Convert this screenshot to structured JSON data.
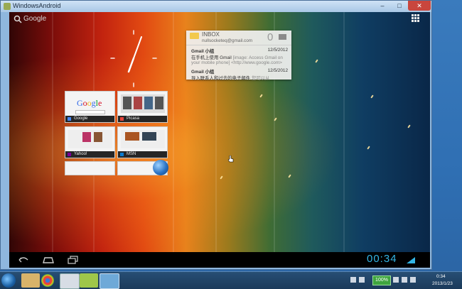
{
  "window": {
    "title": "WindowsAndroid",
    "minimize_glyph": "–",
    "maximize_glyph": "□",
    "close_glyph": "✕"
  },
  "android": {
    "search_label": "Google",
    "icons": {
      "search": "search-icon",
      "apps": "all-apps-icon"
    },
    "clock": {
      "type": "analog",
      "hour_angle_deg": 200,
      "minute_angle_deg": 22
    },
    "gmail_widget": {
      "title": "INBOX",
      "account": "nullsocketeq@gmail.com",
      "unread_count": "0",
      "messages": [
        {
          "from": "Gmail 小组",
          "date": "12/5/2012",
          "subject": "在手机上使用 Gmail",
          "snippet": "[image: Access Gmail on",
          "snippet2": "your mobile phone] <http://www.google.com>"
        },
        {
          "from": "Gmail 小组",
          "date": "12/5/2012",
          "subject": "导入联系人和过去的电子邮件",
          "snippet": "您可以从"
        }
      ]
    },
    "browser_tabs": [
      {
        "label": "Google"
      },
      {
        "label": "Picasa"
      },
      {
        "label": "Yahoo!"
      },
      {
        "label": "MSN"
      }
    ],
    "thumb_google_logo": "Google",
    "nav": {
      "back": "back-icon",
      "home": "home-icon",
      "recents": "recents-icon"
    },
    "time": "00:34"
  },
  "taskbar": {
    "battery": "100%",
    "time": "0:34",
    "date": "2013/1/23"
  },
  "colors": {
    "android_time": "#33b5e5",
    "accent_blue": "#1a5fa3"
  }
}
